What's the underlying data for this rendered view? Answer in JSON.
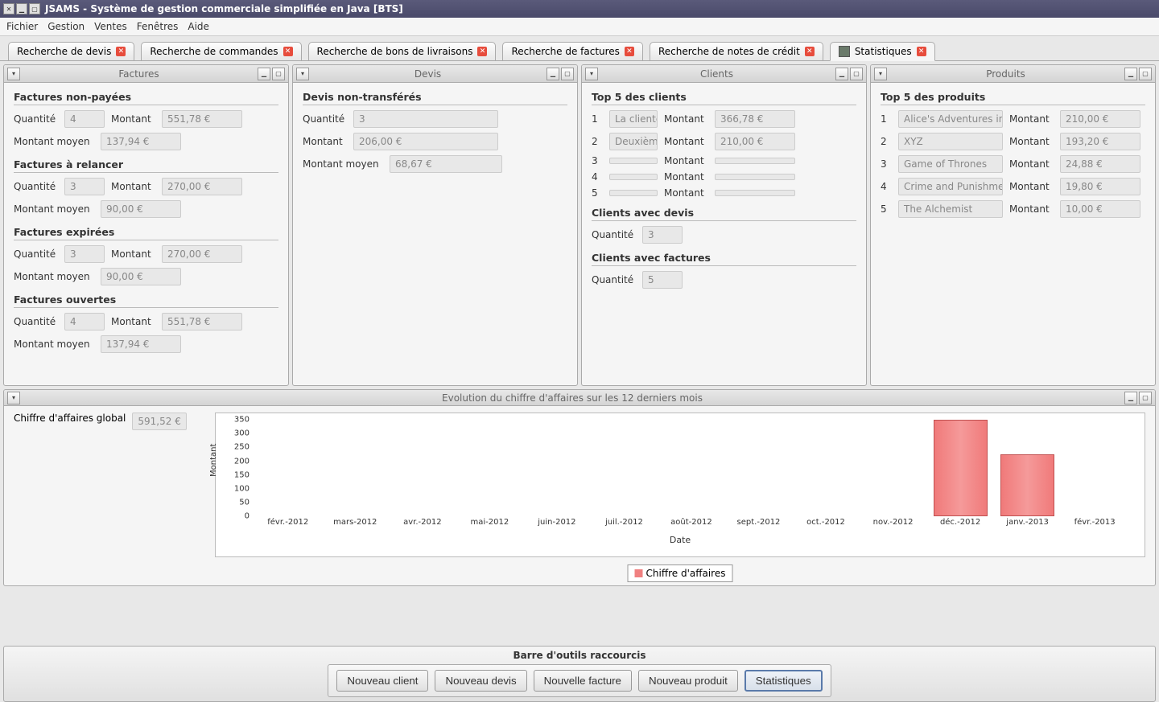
{
  "window": {
    "title": "JSAMS - Système de gestion commerciale simplifiée en Java [BTS]"
  },
  "menu": {
    "fichier": "Fichier",
    "gestion": "Gestion",
    "ventes": "Ventes",
    "fenetres": "Fenêtres",
    "aide": "Aide"
  },
  "tabs": [
    {
      "label": "Recherche de devis"
    },
    {
      "label": "Recherche de commandes"
    },
    {
      "label": "Recherche de bons de livraisons"
    },
    {
      "label": "Recherche de factures"
    },
    {
      "label": "Recherche de notes de crédit"
    },
    {
      "label": "Statistiques"
    }
  ],
  "panel_factures": {
    "title": "Factures"
  },
  "panel_devis": {
    "title": "Devis"
  },
  "panel_clients": {
    "title": "Clients"
  },
  "panel_produits": {
    "title": "Produits"
  },
  "panel_chart": {
    "title": "Evolution du chiffre d'affaires sur les 12 derniers mois"
  },
  "labels": {
    "quantite": "Quantité",
    "montant": "Montant",
    "montant_moyen": "Montant moyen",
    "chiffre_global": "Chiffre d'affaires global"
  },
  "factures": {
    "non_payees": {
      "title": "Factures non-payées",
      "quantite": "4",
      "montant": "551,78 €",
      "moyen": "137,94 €"
    },
    "relancer": {
      "title": "Factures à relancer",
      "quantite": "3",
      "montant": "270,00 €",
      "moyen": "90,00 €"
    },
    "expirees": {
      "title": "Factures expirées",
      "quantite": "3",
      "montant": "270,00 €",
      "moyen": "90,00 €"
    },
    "ouvertes": {
      "title": "Factures ouvertes",
      "quantite": "4",
      "montant": "551,78 €",
      "moyen": "137,94 €"
    }
  },
  "devis": {
    "non_transferes": {
      "title": "Devis non-transférés",
      "quantite": "3",
      "montant": "206,00 €",
      "moyen": "68,67 €"
    }
  },
  "clients": {
    "top5_title": "Top 5 des clients",
    "rows": [
      {
        "rank": "1",
        "name": "La cliente",
        "montant": "366,78 €"
      },
      {
        "rank": "2",
        "name": "Deuxième",
        "montant": "210,00 €"
      },
      {
        "rank": "3",
        "name": "",
        "montant": ""
      },
      {
        "rank": "4",
        "name": "",
        "montant": ""
      },
      {
        "rank": "5",
        "name": "",
        "montant": ""
      }
    ],
    "avec_devis": {
      "title": "Clients avec devis",
      "quantite": "3"
    },
    "avec_factures": {
      "title": "Clients avec factures",
      "quantite": "5"
    }
  },
  "produits": {
    "top5_title": "Top 5 des produits",
    "rows": [
      {
        "rank": "1",
        "name": "Alice's Adventures in",
        "montant": "210,00 €"
      },
      {
        "rank": "2",
        "name": "XYZ",
        "montant": "193,20 €"
      },
      {
        "rank": "3",
        "name": "Game of Thrones",
        "montant": "24,88 €"
      },
      {
        "rank": "4",
        "name": "Crime and Punishme",
        "montant": "19,80 €"
      },
      {
        "rank": "5",
        "name": "The Alchemist",
        "montant": "10,00 €"
      }
    ]
  },
  "chart_global_value": "591,52 €",
  "chart_data": {
    "type": "bar",
    "title": "Evolution du chiffre d'affaires sur les 12 derniers mois",
    "categories": [
      "févr.-2012",
      "mars-2012",
      "avr.-2012",
      "mai-2012",
      "juin-2012",
      "juil.-2012",
      "août-2012",
      "sept.-2012",
      "oct.-2012",
      "nov.-2012",
      "déc.-2012",
      "janv.-2013",
      "févr.-2013"
    ],
    "values": [
      0,
      0,
      0,
      0,
      0,
      0,
      0,
      0,
      0,
      0,
      360,
      225,
      0
    ],
    "xlabel": "Date",
    "ylabel": "Montant",
    "ylim": [
      0,
      350
    ],
    "y_ticks": [
      0,
      50,
      100,
      150,
      200,
      250,
      300,
      350
    ],
    "legend": "Chiffre d'affaires",
    "color": "#f08080"
  },
  "toolbar": {
    "title": "Barre d'outils raccourcis",
    "nouveau_client": "Nouveau client",
    "nouveau_devis": "Nouveau devis",
    "nouvelle_facture": "Nouvelle facture",
    "nouveau_produit": "Nouveau produit",
    "statistiques": "Statistiques"
  }
}
